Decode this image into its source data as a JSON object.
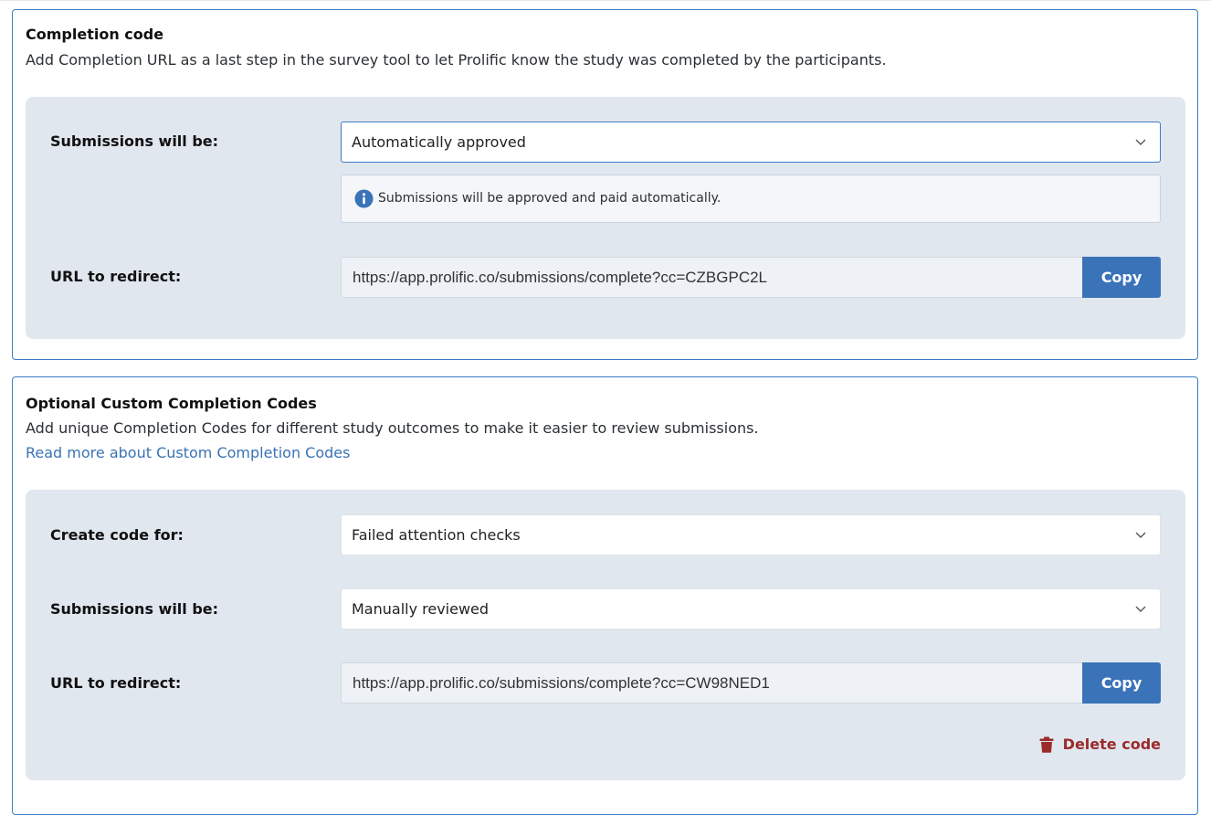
{
  "completion_code": {
    "title": "Completion code",
    "description": "Add Completion URL as a last step in the survey tool to let Prolific know the study was completed by the participants.",
    "submissions_label": "Submissions will be:",
    "submissions_value": "Automatically approved",
    "info_text": "Submissions will be approved and paid automatically.",
    "url_label": "URL to redirect:",
    "url_value": "https://app.prolific.co/submissions/complete?cc=CZBGPC2L",
    "copy_label": "Copy"
  },
  "custom_codes": {
    "title": "Optional Custom Completion Codes",
    "description": "Add unique Completion Codes for different study outcomes to make it easier to review submissions.",
    "link_text": "Read more about Custom Completion Codes",
    "create_label": "Create code for:",
    "create_value": "Failed attention checks",
    "submissions_label": "Submissions will be:",
    "submissions_value": "Manually reviewed",
    "url_label": "URL to redirect:",
    "url_value": "https://app.prolific.co/submissions/complete?cc=CW98NED1",
    "copy_label": "Copy",
    "delete_label": "Delete code"
  },
  "icons": {
    "info": "info-circle-icon",
    "chevron": "chevron-down-icon",
    "trash": "trash-icon"
  },
  "colors": {
    "accent": "#3a73b8",
    "panel": "#e1e7ef",
    "danger": "#9b2a2a",
    "card_border": "#3d7bc4"
  }
}
